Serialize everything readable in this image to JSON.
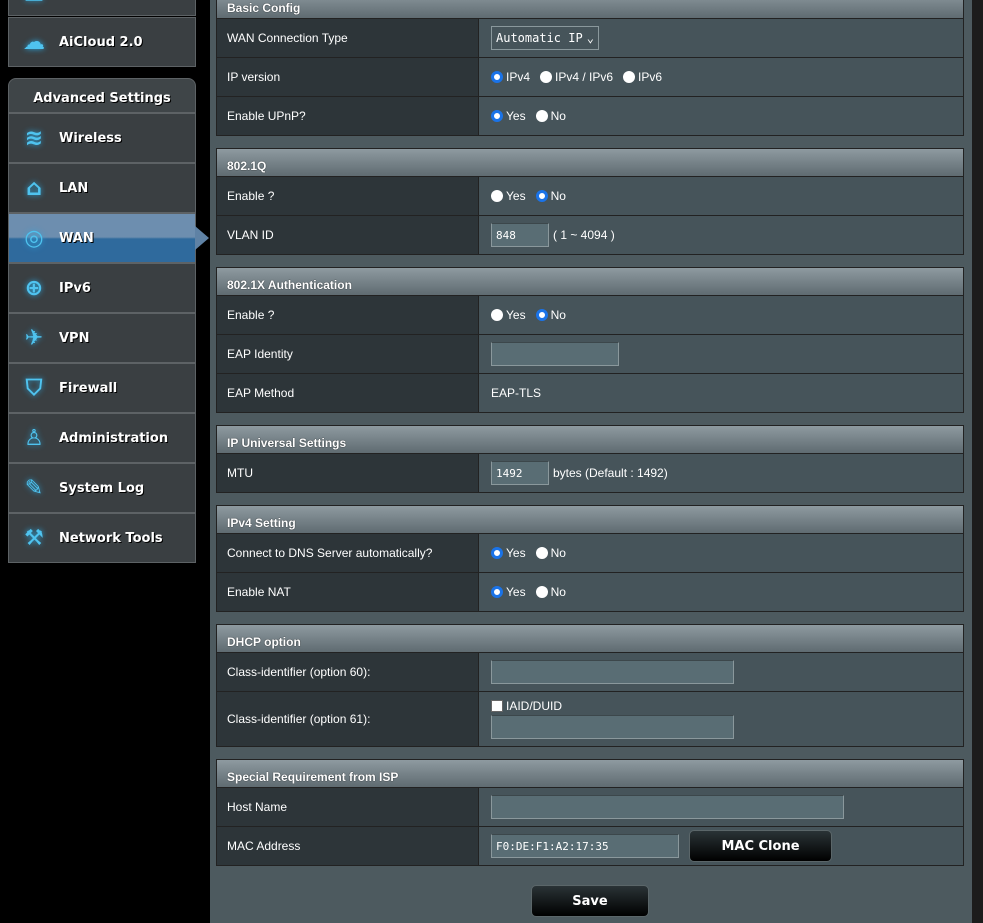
{
  "sidebar": {
    "top_items": [
      {
        "label": "",
        "icon": "apps-icon"
      },
      {
        "label": "AiCloud 2.0",
        "icon": "aicloud-icon"
      }
    ],
    "advanced_header": "Advanced Settings",
    "items": [
      {
        "label": "Wireless",
        "icon": "wifi-icon",
        "active": false
      },
      {
        "label": "LAN",
        "icon": "home-icon",
        "active": false
      },
      {
        "label": "WAN",
        "icon": "globe-icon",
        "active": true
      },
      {
        "label": "IPv6",
        "icon": "ipv6-globe-icon",
        "active": false
      },
      {
        "label": "VPN",
        "icon": "vpn-icon",
        "active": false
      },
      {
        "label": "Firewall",
        "icon": "shield-icon",
        "active": false
      },
      {
        "label": "Administration",
        "icon": "user-icon",
        "active": false
      },
      {
        "label": "System Log",
        "icon": "edit-log-icon",
        "active": false
      },
      {
        "label": "Network Tools",
        "icon": "wrench-icon",
        "active": false
      }
    ]
  },
  "sections": [
    {
      "title": "Basic Config",
      "rows": [
        {
          "label": "WAN Connection Type",
          "type": "select",
          "value": "Automatic IP"
        },
        {
          "label": "IP version",
          "type": "radio",
          "options": [
            "IPv4",
            "IPv4 / IPv6",
            "IPv6"
          ],
          "selected": 0
        },
        {
          "label": "Enable UPnP?",
          "type": "radio",
          "options": [
            "Yes",
            "No"
          ],
          "selected": 0
        }
      ]
    },
    {
      "title": "802.1Q",
      "rows": [
        {
          "label": "Enable ?",
          "type": "radio",
          "options": [
            "Yes",
            "No"
          ],
          "selected": 1
        },
        {
          "label": "VLAN ID",
          "type": "input",
          "value": "848",
          "width": 58,
          "suffix": "( 1 ~ 4094 )"
        }
      ]
    },
    {
      "title": "802.1X Authentication",
      "rows": [
        {
          "label": "Enable ?",
          "type": "radio",
          "options": [
            "Yes",
            "No"
          ],
          "selected": 1
        },
        {
          "label": "EAP Identity",
          "type": "input",
          "value": "",
          "width": 128
        },
        {
          "label": "EAP Method",
          "type": "text",
          "value": "EAP-TLS"
        }
      ]
    },
    {
      "title": "IP Universal Settings",
      "rows": [
        {
          "label": "MTU",
          "type": "input",
          "value": "1492",
          "width": 58,
          "suffix": "bytes (Default : 1492)"
        }
      ]
    },
    {
      "title": "IPv4 Setting",
      "rows": [
        {
          "label": "Connect to DNS Server automatically?",
          "type": "radio",
          "options": [
            "Yes",
            "No"
          ],
          "selected": 0
        },
        {
          "label": "Enable NAT",
          "type": "radio",
          "options": [
            "Yes",
            "No"
          ],
          "selected": 0
        }
      ]
    },
    {
      "title": "DHCP option",
      "rows": [
        {
          "label": "Class-identifier (option 60):",
          "type": "input",
          "value": "",
          "width": 243
        },
        {
          "label": "Class-identifier (option 61):",
          "type": "checkinput",
          "check_label": "IAID/DUID",
          "checked": false,
          "value": "",
          "width": 243
        }
      ]
    },
    {
      "title": "Special Requirement from ISP",
      "rows": [
        {
          "label": "Host Name",
          "type": "input",
          "value": "",
          "width": 353
        },
        {
          "label": "MAC Address",
          "type": "mac",
          "value": "F0:DE:F1:A2:17:35",
          "button": "MAC Clone"
        }
      ]
    }
  ],
  "save_label": "Save"
}
